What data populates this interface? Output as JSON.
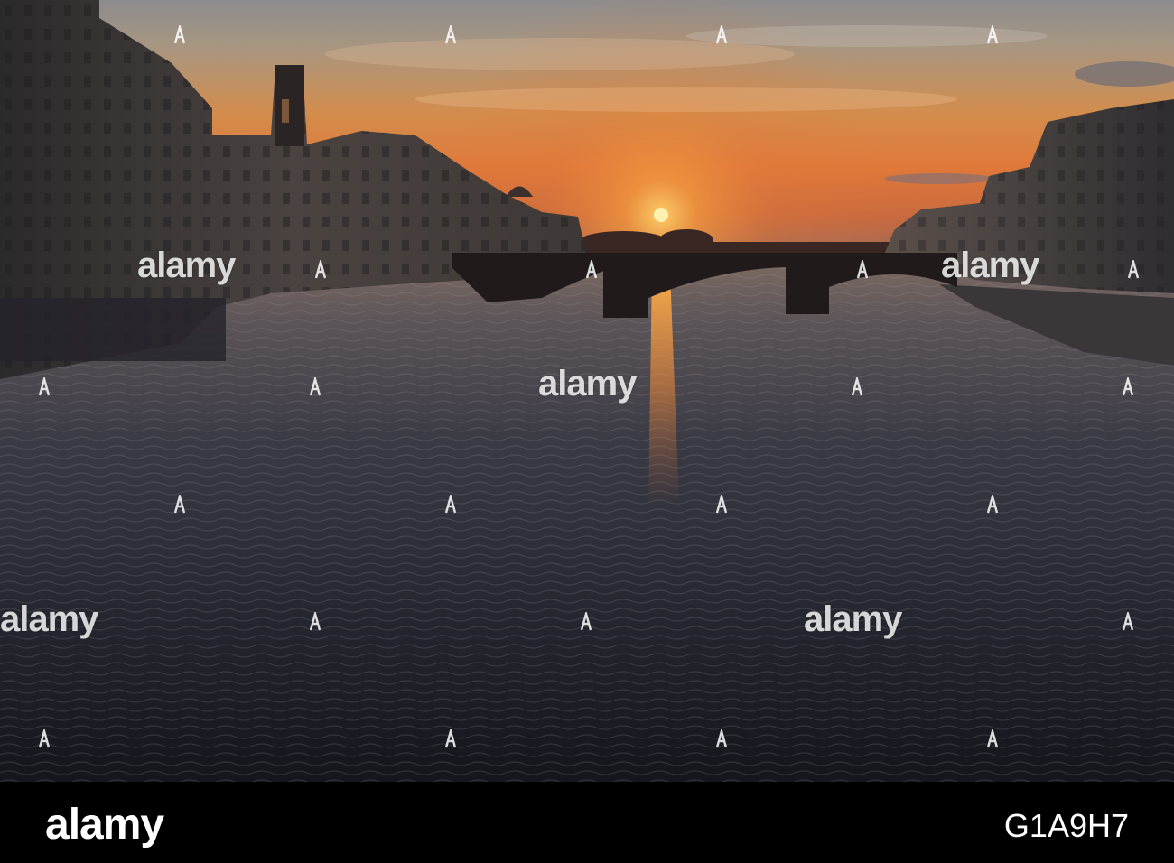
{
  "image": {
    "subject": "sunset over river with arched bridge between two rows of riverside buildings",
    "colors": {
      "sky_top": "#8a8a8c",
      "sky_glow": "#e08a3c",
      "sun": "#ffe58a",
      "water_dark": "#1b1d24",
      "buildings": "#3b3a3a"
    }
  },
  "watermark": {
    "text": "alamy",
    "icon": "alamy-mark-icon"
  },
  "footer": {
    "logo": "alamy",
    "image_id": "G1A9H7"
  }
}
